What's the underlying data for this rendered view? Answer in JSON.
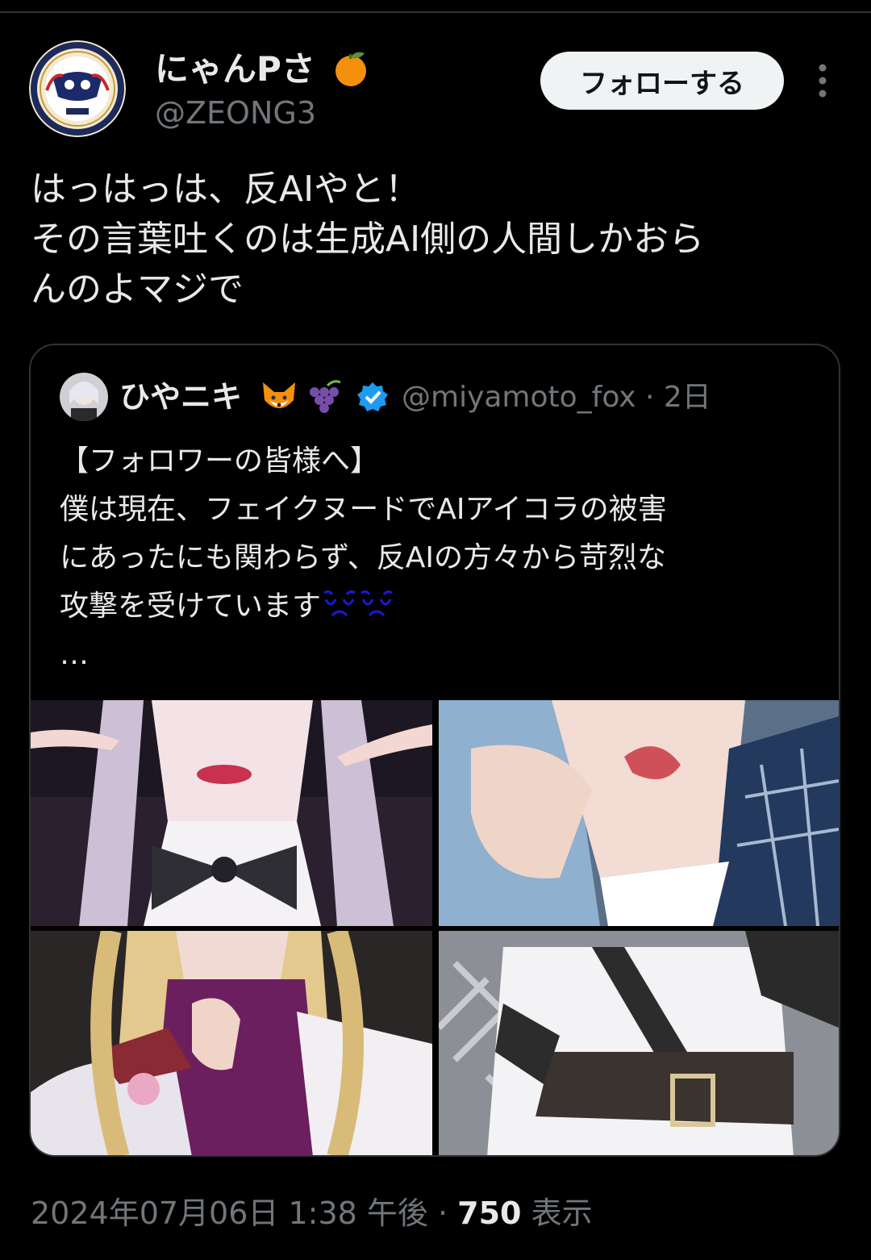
{
  "author": {
    "display_name": "にゃんPさ",
    "name_emoji": "tangerine-emoji",
    "handle": "@ZEONG3"
  },
  "follow_button": {
    "label": "フォローする"
  },
  "more_icon": "more-vertical-icon",
  "tweet": {
    "lines": [
      "はっはっは、反AIやと！",
      "その言葉吐くのは生成AI側の人間しかおら",
      "んのよマジで"
    ]
  },
  "quote": {
    "display_name": "ひやニキ",
    "name_emojis": [
      "fox-emoji",
      "grapes-emoji"
    ],
    "verified": true,
    "handle_and_time": "@miyamoto_fox · 2日",
    "lines": [
      "【フォロワーの皆様へ】",
      "僕は現在、フェイクヌードでAIアイコラの被害",
      "にあったにも関わらず、反AIの方々から苛烈な",
      "攻撃を受けています"
    ],
    "ellipsis": "…",
    "media": [
      "photo-1",
      "photo-2",
      "photo-3",
      "photo-4"
    ]
  },
  "footer": {
    "date_time": "2024年07月06日 1:38 午後 · ",
    "views_count": "750",
    "views_label": " 表示"
  },
  "colors": {
    "background": "#000000",
    "text_primary": "#e7e9ea",
    "text_secondary": "#71767b",
    "border": "#2f3336",
    "verified": "#1d9bf0"
  }
}
